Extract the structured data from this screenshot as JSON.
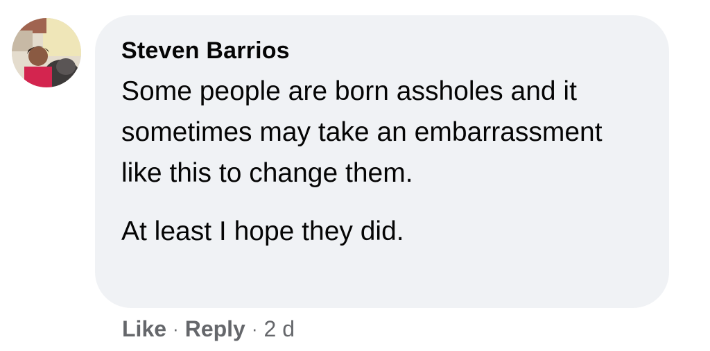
{
  "comment": {
    "author": "Steven Barrios",
    "paragraphs": [
      "Some people are born assholes and it sometimes may take an embarrassment like this to change them.",
      "At least I hope they did."
    ],
    "actions": {
      "like_label": "Like",
      "reply_label": "Reply",
      "separator": "·",
      "timestamp": "2 d"
    }
  },
  "colors": {
    "bubble_bg": "#f0f2f5",
    "text": "#050505",
    "secondary_text": "#65676b"
  }
}
